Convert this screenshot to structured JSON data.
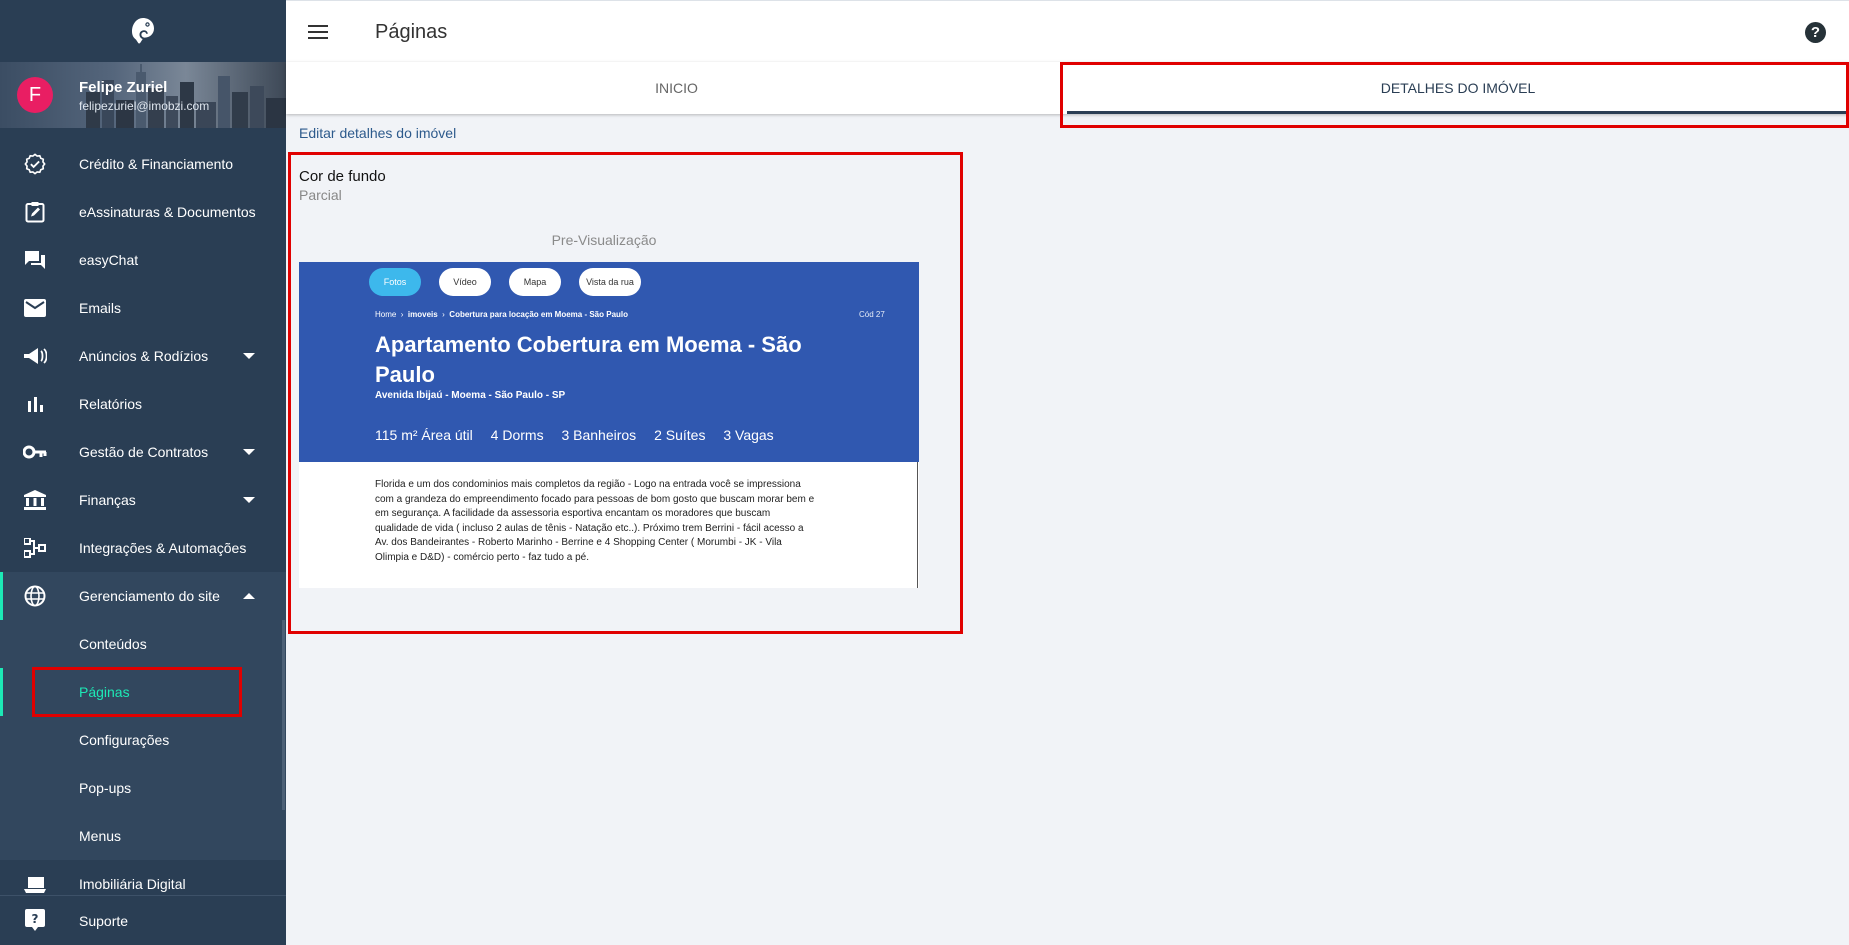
{
  "sidebar": {
    "profile": {
      "initial": "F",
      "name": "Felipe Zuriel",
      "email": "felipezuriel@imobzi.com"
    },
    "items": [
      {
        "label": "Crédito & Financiamento",
        "icon": "badge-check-icon"
      },
      {
        "label": "eAssinaturas & Documentos",
        "icon": "clipboard-edit-icon"
      },
      {
        "label": "easyChat",
        "icon": "chat-icon"
      },
      {
        "label": "Emails",
        "icon": "mail-icon"
      },
      {
        "label": "Anúncios & Rodízios",
        "icon": "megaphone-icon"
      },
      {
        "label": "Relatórios",
        "icon": "bar-chart-icon"
      },
      {
        "label": "Gestão de Contratos",
        "icon": "key-icon"
      },
      {
        "label": "Finanças",
        "icon": "bank-icon"
      },
      {
        "label": "Integrações & Automações",
        "icon": "integration-icon"
      },
      {
        "label": "Gerenciamento do site",
        "icon": "globe-icon"
      }
    ],
    "sub_items": [
      "Conteúdos",
      "Páginas",
      "Configurações",
      "Pop-ups",
      "Menus"
    ],
    "partial_item": "Imobiliária Digital",
    "support": "Suporte"
  },
  "header": {
    "title": "Páginas",
    "help": "?"
  },
  "tabs": [
    "INICIO",
    "DETALHES DO IMÓVEL"
  ],
  "main": {
    "subtitle": "Editar detalhes do imóvel",
    "cor_label": "Cor de fundo",
    "cor_value": "Parcial",
    "preview_label": "Pre-Visualização"
  },
  "preview": {
    "pills": [
      "Fotos",
      "Vídeo",
      "Mapa",
      "Vista da rua"
    ],
    "crumb_home": "Home",
    "crumb_sep": "›",
    "crumb_imoveis": "imoveis",
    "crumb_current": "Cobertura para locação em Moema - São Paulo",
    "cod": "Cód 27",
    "title": "Apartamento Cobertura em Moema - São Paulo",
    "address": "Avenida Ibijaú - Moema - São Paulo - SP",
    "stats": [
      "115 m² Área útil",
      "4 Dorms",
      "3 Banheiros",
      "2 Suítes",
      "3 Vagas"
    ],
    "description": "Florida e um dos condominios mais completos da região - Logo na entrada você se impressiona com a grandeza do empreendimento focado para pessoas de bom gosto que buscam morar bem e em segurança. A facilidade da assessoria esportiva encantam os moradores que buscam qualidade de vida ( incluso 2 aulas de tênis - Natação etc..). Próximo trem Berrini - fácil acesso a Av. dos Bandeirantes - Roberto Marinho - Berrine e 4 Shopping Center ( Morumbi - JK - Vila Olimpia e D&D) - comércio perto - faz tudo a pé."
  },
  "colors": {
    "sidebar": "#2a3e54",
    "accent": "#1de9b6",
    "hero": "#3058b0",
    "annotation": "#e00000"
  }
}
